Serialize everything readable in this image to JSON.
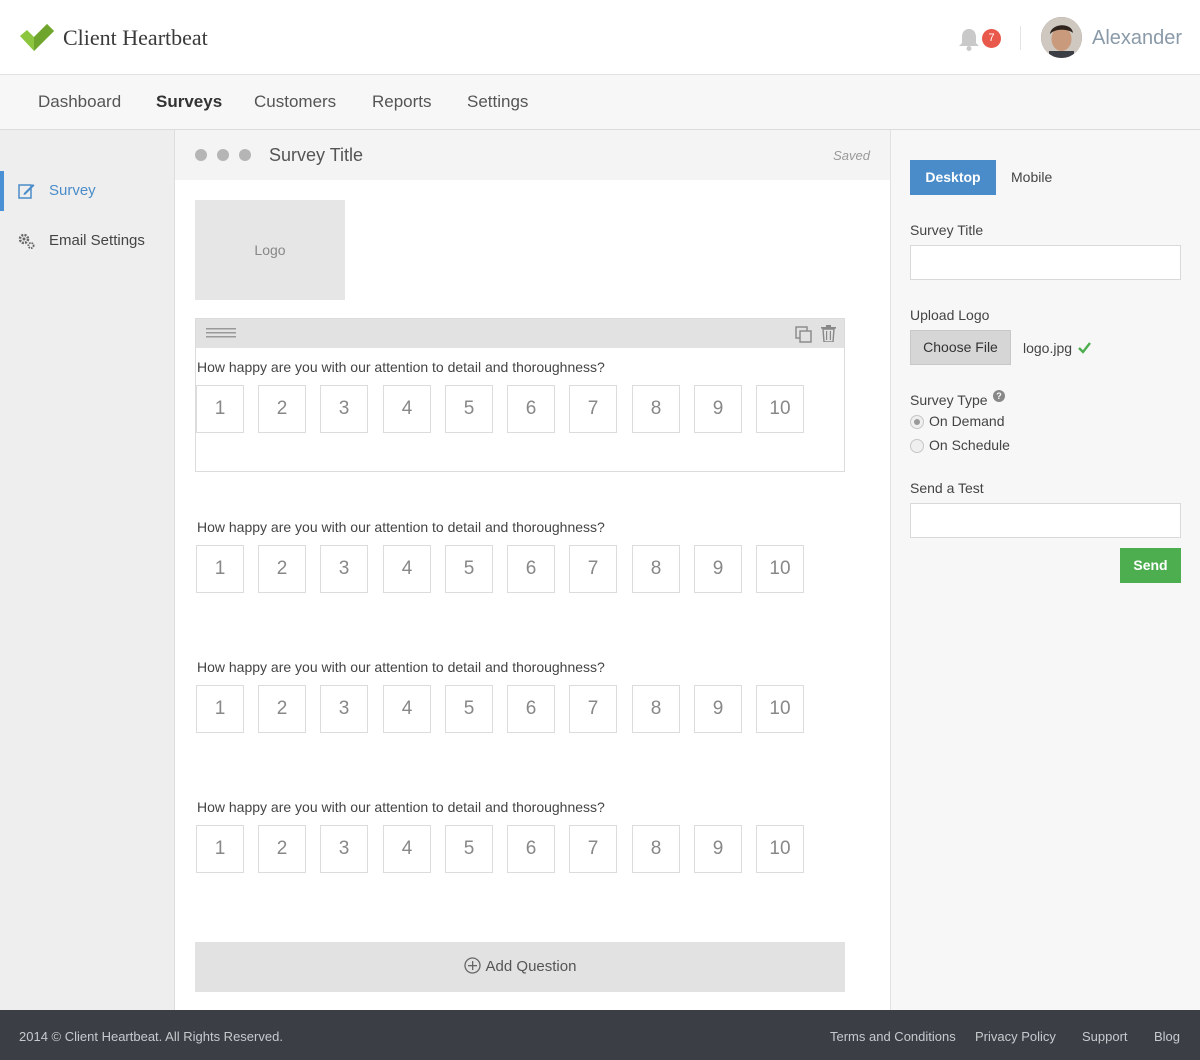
{
  "app": {
    "brand": "Client Heartbeat",
    "notifications_count": "7",
    "user_name": "Alexander",
    "accent_color": "#4a8cc9",
    "logo_color": "#8cc63f"
  },
  "nav": {
    "items": [
      {
        "label": "Dashboard"
      },
      {
        "label": "Surveys",
        "active": true
      },
      {
        "label": "Customers"
      },
      {
        "label": "Reports"
      },
      {
        "label": "Settings"
      }
    ]
  },
  "sidebar": {
    "items": [
      {
        "label": "Survey",
        "icon": "edit-icon",
        "active": true
      },
      {
        "label": "Email Settings",
        "icon": "gears-icon"
      }
    ]
  },
  "editor": {
    "title": "Survey Title",
    "status": "Saved",
    "logo_placeholder": "Logo",
    "questions": [
      {
        "text": "How happy are you with our attention to detail and thoroughness?",
        "scale": [
          "1",
          "2",
          "3",
          "4",
          "5",
          "6",
          "7",
          "8",
          "9",
          "10"
        ]
      },
      {
        "text": "How happy are you with our attention to detail and thoroughness?",
        "scale": [
          "1",
          "2",
          "3",
          "4",
          "5",
          "6",
          "7",
          "8",
          "9",
          "10"
        ]
      },
      {
        "text": "How happy are you with our attention to detail and thoroughness?",
        "scale": [
          "1",
          "2",
          "3",
          "4",
          "5",
          "6",
          "7",
          "8",
          "9",
          "10"
        ]
      },
      {
        "text": "How happy are you with our attention to detail and thoroughness?",
        "scale": [
          "1",
          "2",
          "3",
          "4",
          "5",
          "6",
          "7",
          "8",
          "9",
          "10"
        ]
      }
    ],
    "add_question_label": "Add Question"
  },
  "panel": {
    "view_desktop": "Desktop",
    "view_mobile": "Mobile",
    "survey_title_label": "Survey Title",
    "survey_title_value": "",
    "upload_logo_label": "Upload Logo",
    "choose_file_label": "Choose File",
    "file_name": "logo.jpg",
    "survey_type_label": "Survey Type",
    "help_glyph": "?",
    "survey_type_options": [
      {
        "label": "On Demand",
        "checked": true
      },
      {
        "label": "On Schedule",
        "checked": false
      }
    ],
    "send_test_label": "Send a Test",
    "send_test_value": "",
    "send_label": "Send",
    "send_color": "#4cae4f"
  },
  "footer": {
    "copyright": "2014 © Client Heartbeat. All Rights Reserved.",
    "links": [
      "Terms and Conditions",
      "Privacy Policy",
      "Support",
      "Blog"
    ]
  }
}
